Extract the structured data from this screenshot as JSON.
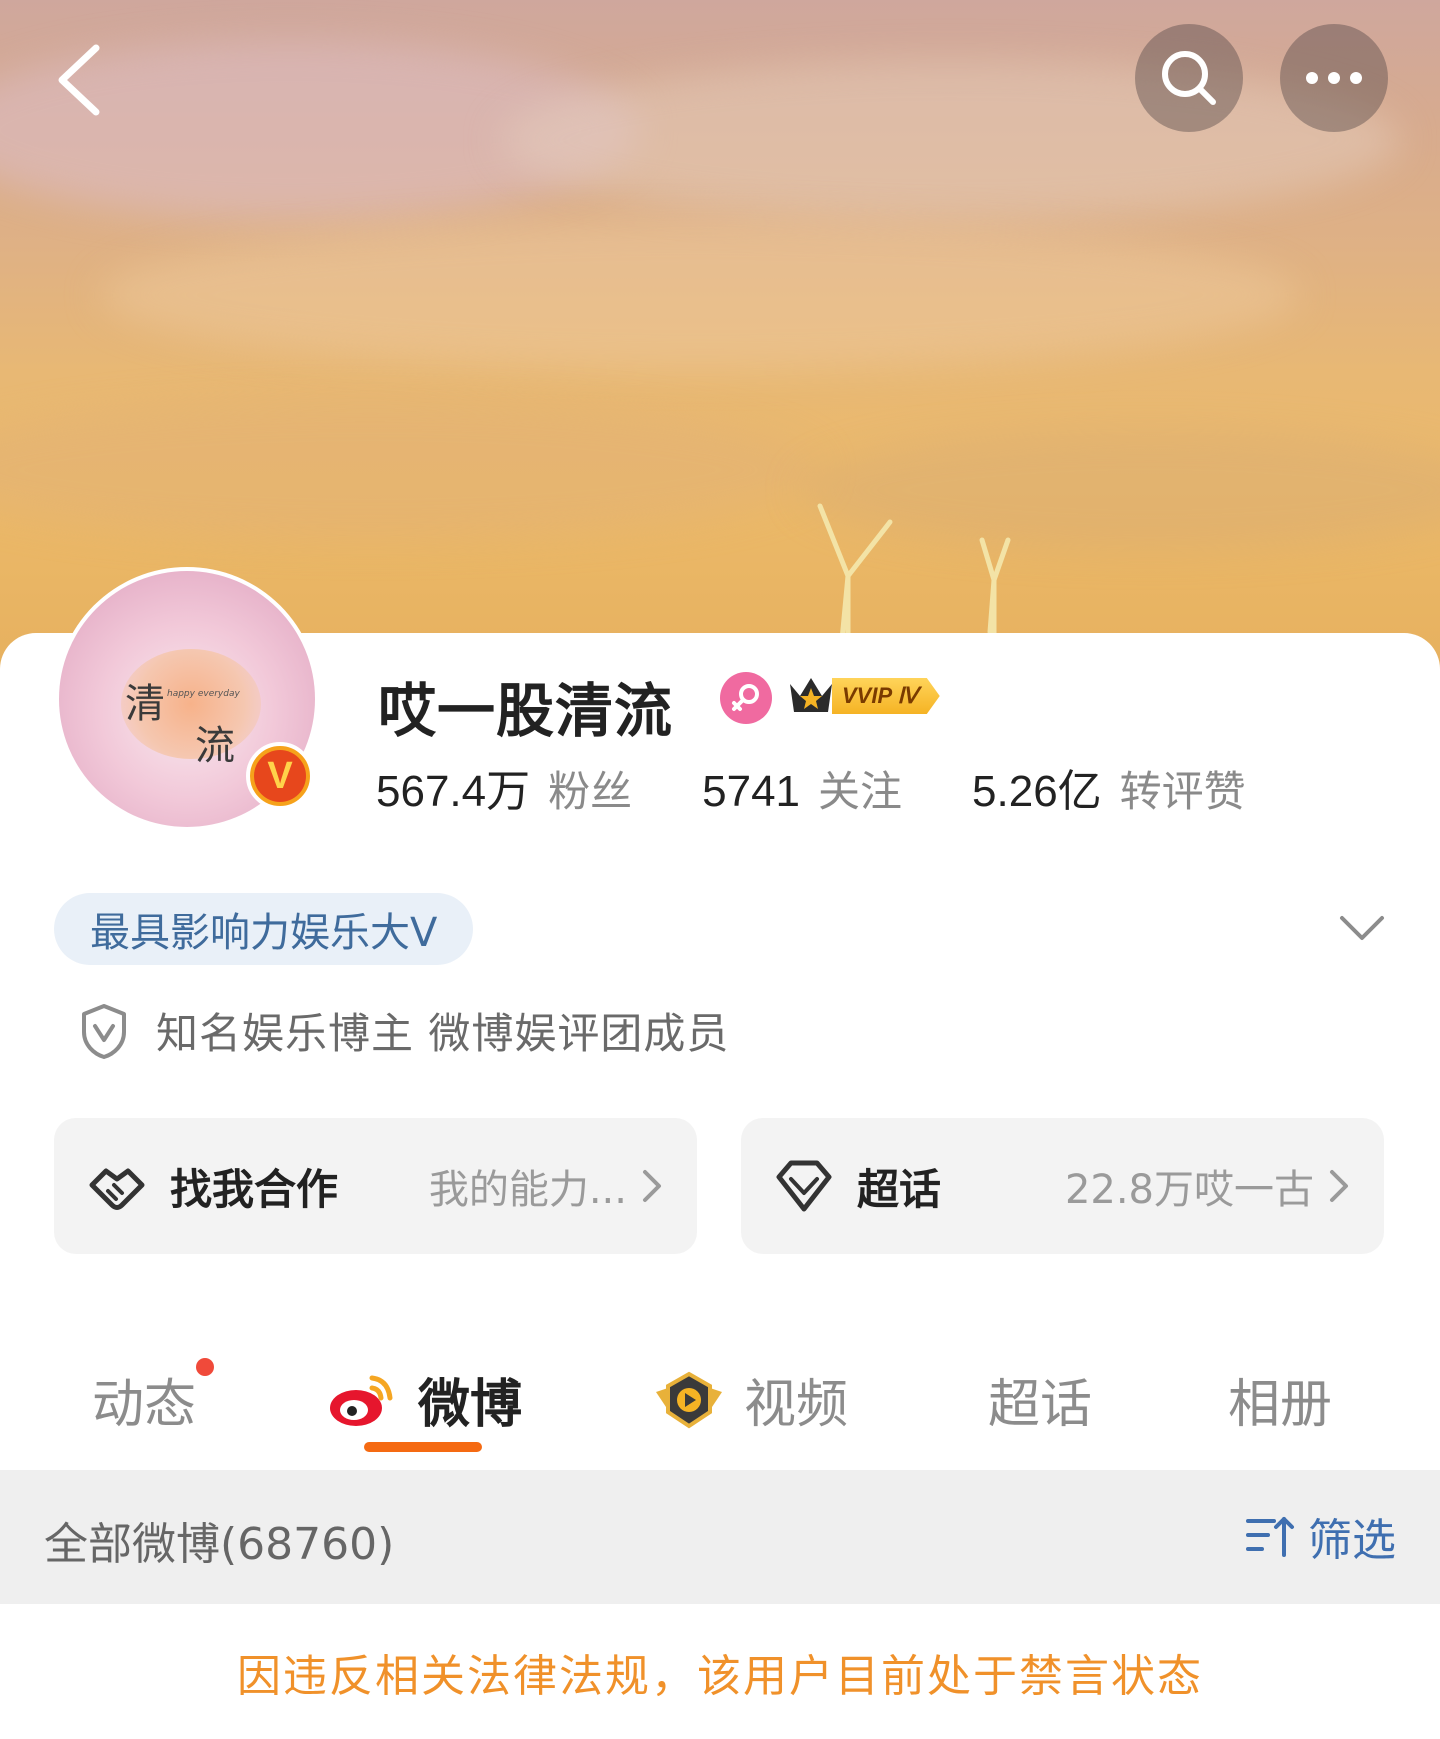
{
  "header": {
    "back_icon": "chevron-left-icon",
    "search_icon": "search-icon",
    "more_icon": "more-dots-icon"
  },
  "profile": {
    "avatar_text_1": "清",
    "avatar_text_2": "流",
    "avatar_small_text": "happy everyday",
    "verified_badge": "V",
    "name": "哎一股清流",
    "vvip_label": "VVIP Ⅳ",
    "stats": [
      {
        "value": "567.4万",
        "label": "粉丝"
      },
      {
        "value": "5741",
        "label": "关注"
      },
      {
        "value": "5.26亿",
        "label": "转评赞"
      }
    ],
    "honor_tag": "最具影响力娱乐大V",
    "verification": "知名娱乐博主 微博娱评团成员"
  },
  "entries": {
    "cooperate": {
      "title": "找我合作",
      "sub": "我的能力..."
    },
    "supertopic": {
      "title": "超话",
      "sub": "22.8万哎一古"
    }
  },
  "tabs": [
    {
      "label": "动态"
    },
    {
      "label": "微博"
    },
    {
      "label": "视频"
    },
    {
      "label": "超话"
    },
    {
      "label": "相册"
    }
  ],
  "filter": {
    "all_count": "全部微博(68760)",
    "filter_label": "筛选"
  },
  "notice": "因违反相关法律法规，该用户目前处于禁言状态",
  "colors": {
    "accent": "#f56a12",
    "link_blue": "#3f6fb0",
    "notice": "#f0912a",
    "gender_pink": "#f06aa0"
  }
}
